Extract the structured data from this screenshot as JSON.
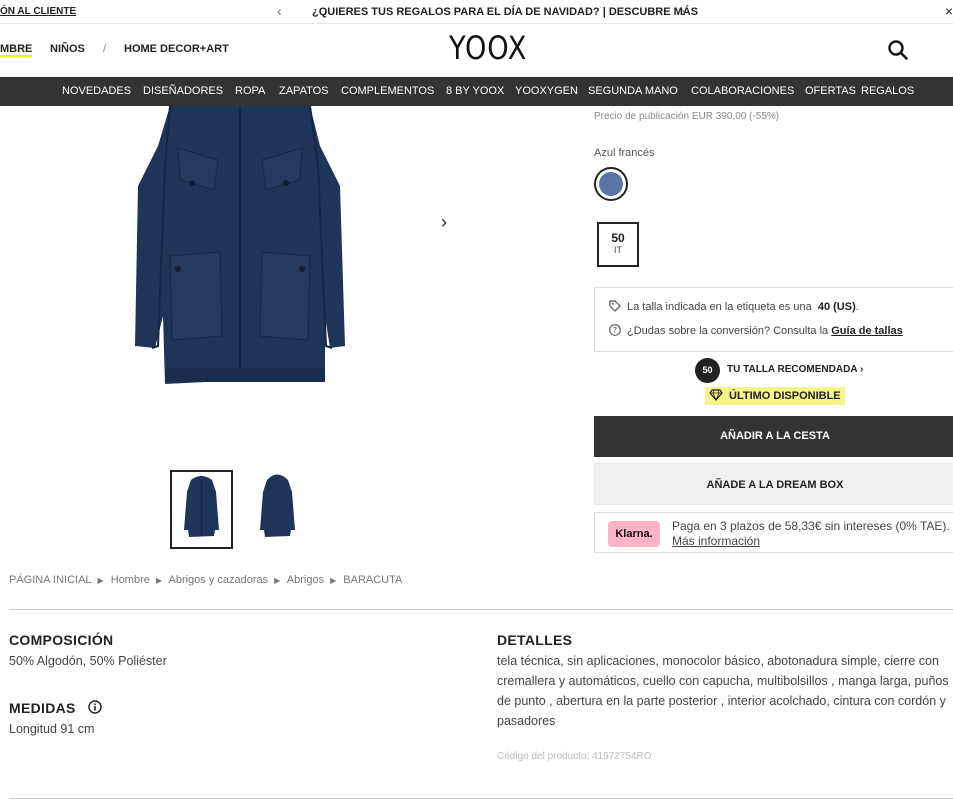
{
  "promo": {
    "left_link": "ÓN AL CLIENTE",
    "message": "¿QUIERES TUS REGALOS PARA EL DÍA DE NAVIDAD? | DESCUBRE MÁS"
  },
  "header": {
    "logo": "YOOX",
    "gender_nav": [
      "MBRE",
      "NIÑOS",
      "/",
      "HOME DECOR+ART"
    ]
  },
  "categories": [
    "NOVEDADES",
    "DISEÑADORES",
    "ROPA",
    "ZAPATOS",
    "COMPLEMENTOS",
    "8 BY YOOX",
    "YOOXYGEN",
    "SEGUNDA MANO",
    "COLABORACIONES",
    "OFERTAS",
    "REGALOS"
  ],
  "breadcrumb": [
    "PÁGINA INICIAL",
    "Hombre",
    "Abrigos y cazadoras",
    "Abrigos",
    "BARACUTA"
  ],
  "product": {
    "publication_price": "Precio de publicación   EUR 390,00 (-55%)",
    "color_name": "Azul francés",
    "color_hex": "#5b75a3",
    "size": {
      "value": "50",
      "system": "IT"
    },
    "size_label_info": {
      "prefix": "La talla indicada en la etiqueta es una",
      "value": "40 (US)",
      "suffix": "."
    },
    "conversion_info": {
      "prefix": "¿Dudas sobre la conversión? Consulta la",
      "link": "Guía de tallas"
    },
    "recommended": {
      "size": "50",
      "label": "TU TALLA RECOMENDADA"
    },
    "availability": "ÚLTIMO DISPONIBLE",
    "add_to_cart": "AÑADIR A LA CESTA",
    "add_to_dream_box": "AÑADE A LA DREAM BOX",
    "klarna": {
      "logo": "Klarna.",
      "text": "Paga en 3 plazos de 58,33€ sin intereses (0% TAE).",
      "link": "Más información"
    }
  },
  "details": {
    "composition_title": "COMPOSICIÓN",
    "composition": "50% Algodón, 50% Poliéster",
    "measures_title": "MEDIDAS",
    "measures": "Longitud 91 cm",
    "details_title": "DETALLES",
    "details_text": "tela técnica, sin aplicaciones, monocolor básico, abotonadura simple, cierre con cremallera y automáticos, cuello con capucha, multibolsillos , manga larga, puños de punto , abertura en la parte posterior , interior acolchado, cintura con cordón y pasadores",
    "product_code": "Código del producto: 41972754RO"
  },
  "colors": {
    "nav_bg": "#333333",
    "coat": "#1f3459",
    "highlight": "#f5f58a",
    "klarna_pink": "#ffb3c7"
  }
}
